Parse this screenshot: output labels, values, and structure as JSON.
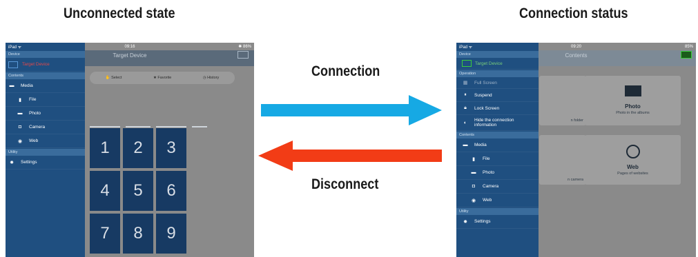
{
  "headings": {
    "left": "Unconnected state",
    "right": "Connection status"
  },
  "arrows": {
    "connect_label": "Connection",
    "disconnect_label": "Disconnect",
    "connect_color": "#16a9e4",
    "disconnect_color": "#f23c16"
  },
  "left_screen": {
    "status": {
      "carrier": "iPad ᯤ",
      "time": "09:16",
      "battery": "✱ 86%"
    },
    "title": "Target Device",
    "segments": [
      "Select",
      "Favorite",
      "History"
    ],
    "keys": [
      "1",
      "2",
      "3",
      "4",
      "5",
      "6",
      "7",
      "8",
      "9"
    ],
    "sidebar": {
      "sections": {
        "device": "Device",
        "contents": "Contents",
        "utility": "Utility"
      },
      "items": {
        "target": "Target Device",
        "media": "Media",
        "file": "File",
        "photo": "Photo",
        "camera": "Camera",
        "web": "Web",
        "settings": "Settings"
      }
    }
  },
  "right_screen": {
    "status": {
      "carrier": "iPad ᯤ",
      "time": "09:20",
      "battery": "85%"
    },
    "title": "Contents",
    "cards": [
      {
        "title": "",
        "sub": "n folder"
      },
      {
        "title": "Photo",
        "sub": "Photo in the albums"
      },
      {
        "title": "",
        "sub": "n camera"
      },
      {
        "title": "Web",
        "sub": "Pages of websites"
      }
    ],
    "sidebar": {
      "sections": {
        "device": "Device",
        "operation": "Operation",
        "contents": "Contents",
        "utility": "Utility"
      },
      "items": {
        "target": "Target Device",
        "fullscreen": "Full Screen",
        "suspend": "Suspend",
        "lock": "Lock Screen",
        "hide": "Hide the connection information",
        "media": "Media",
        "file": "File",
        "photo": "Photo",
        "camera": "Camera",
        "web": "Web",
        "settings": "Settings"
      }
    }
  }
}
